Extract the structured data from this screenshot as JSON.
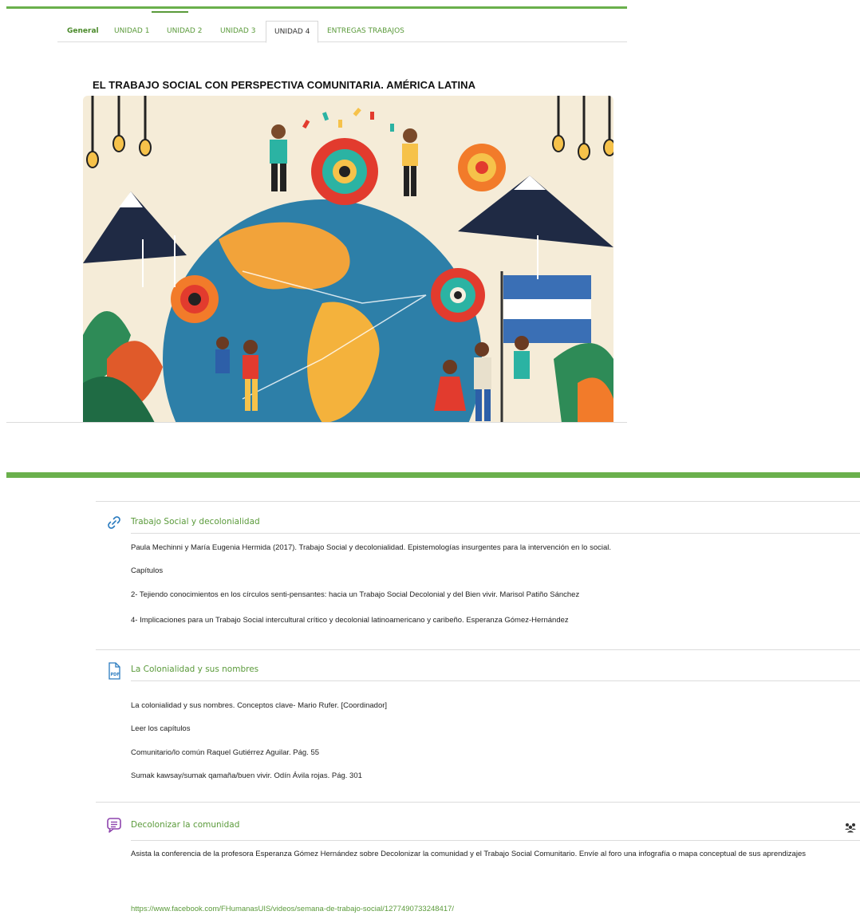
{
  "tabs": [
    {
      "label": "General"
    },
    {
      "label": "UNIDAD 1"
    },
    {
      "label": "UNIDAD 2"
    },
    {
      "label": "UNIDAD 3"
    },
    {
      "label": "UNIDAD 4"
    },
    {
      "label": "ENTREGAS TRABAJOS"
    }
  ],
  "active_tab": "UNIDAD 4",
  "section": {
    "title": "EL TRABAJO SOCIAL CON PERSPECTIVA COMUNITARIA. AMÉRICA LATINA"
  },
  "activities": [
    {
      "icon": "link-icon",
      "title": "Trabajo Social y decolonialidad",
      "lines": [
        "Paula Mechinni y María Eugenia Hermida (2017). Trabajo Social y decolonialidad. Epistemologías insurgentes para la intervención en lo social.",
        "Capítulos",
        "2- Tejiendo conocimientos en los círculos senti-pensantes: hacia un Trabajo Social Decolonial y del Bien vivir.  Marisol Patiño Sánchez",
        "4- Implicaciones para un Trabajo Social intercultural crítico y decolonial latinoamericano y caribeño.  Esperanza Gómez-Hernández"
      ]
    },
    {
      "icon": "pdf-icon",
      "title": "La Colonialidad y sus nombres",
      "lines": [
        "La colonialidad y sus nombres. Conceptos clave- Mario Rufer. [Coordinador]",
        "Leer los capítulos",
        "Comunitario/lo común Raquel Gutiérrez Aguilar. Pág. 55",
        "Sumak kawsay/sumak qamaña/buen vivir.  Odín Ávila rojas. Pág. 301"
      ]
    },
    {
      "icon": "forum-icon",
      "title": "Decolonizar la comunidad",
      "lines": [
        "Asista la conferencia de la profesora Esperanza Gómez Hernández sobre Decolonizar la comunidad y el Trabajo Social Comunitario. Envíe al foro una infografía o mapa conceptual de sus aprendizajes"
      ],
      "link": "https://www.facebook.com/FHumanasUIS/videos/semana-de-trabajo-social/1277490733248417/"
    }
  ],
  "colors": {
    "accent_green": "#6ab04c",
    "link_green": "#5a9a3a",
    "forum_purple": "#8e44ad",
    "pdf_blue": "#2a7bbf"
  }
}
